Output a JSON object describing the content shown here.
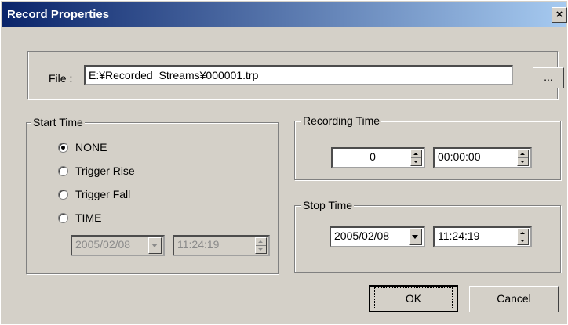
{
  "window": {
    "title": "Record Properties",
    "close_glyph": "×"
  },
  "file": {
    "label": "File :",
    "value": "E:¥Recorded_Streams¥000001.trp",
    "browse_label": "..."
  },
  "start_time": {
    "legend": "Start Time",
    "options": [
      {
        "label": "NONE",
        "selected": true
      },
      {
        "label": "Trigger Rise",
        "selected": false
      },
      {
        "label": "Trigger Fall",
        "selected": false
      },
      {
        "label": "TIME",
        "selected": false
      }
    ],
    "date": "2005/02/08",
    "time": "11:24:19"
  },
  "recording_time": {
    "legend": "Recording Time",
    "count": "0",
    "duration": "00:00:00"
  },
  "stop_time": {
    "legend": "Stop Time",
    "date": "2005/02/08",
    "time": "11:24:19"
  },
  "buttons": {
    "ok": "OK",
    "cancel": "Cancel"
  }
}
